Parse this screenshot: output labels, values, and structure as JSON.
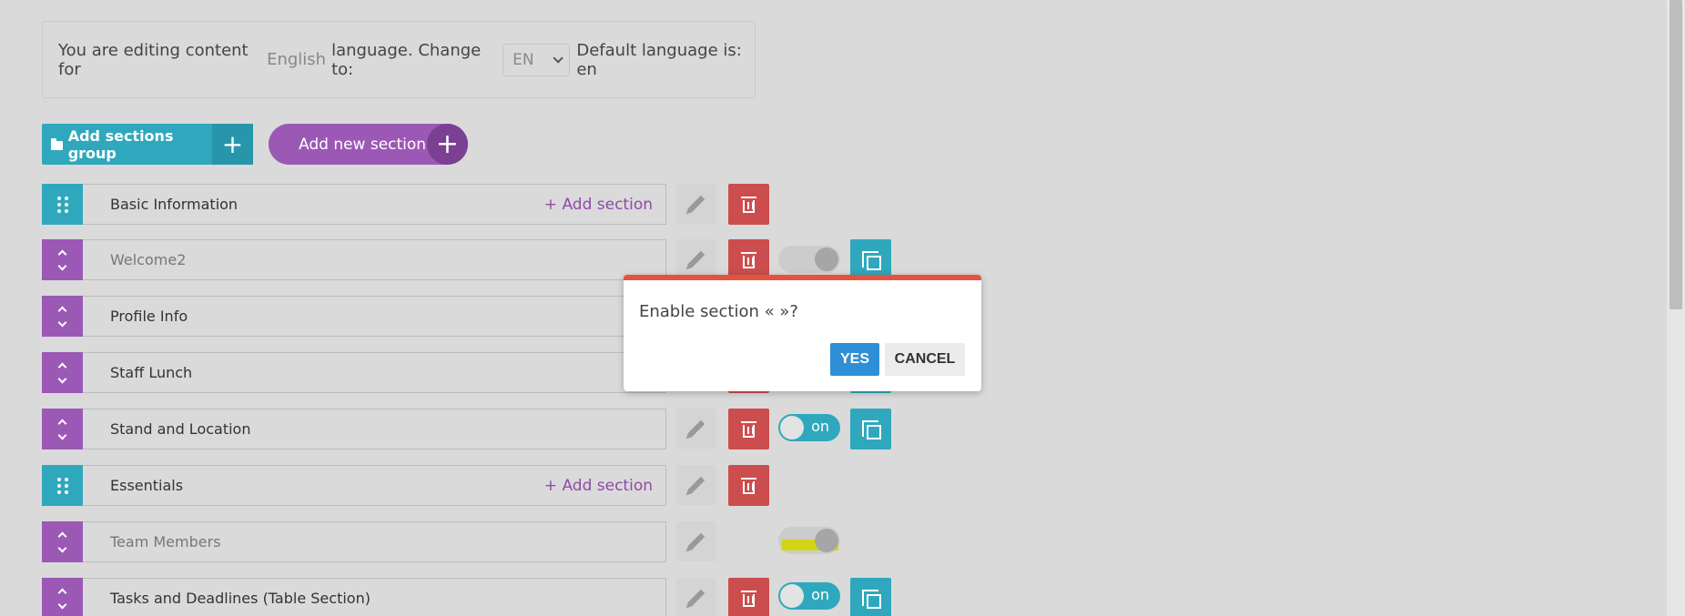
{
  "language_bar": {
    "prefix": "You are editing content for",
    "language": "English",
    "middle": "language. Change to:",
    "selected": "EN",
    "suffix": "Default language is: en"
  },
  "toolbar": {
    "add_group_label": "Add sections group",
    "add_section_label": "Add new section",
    "plus": "+"
  },
  "rows": [
    {
      "label": "Basic Information",
      "kind": "group",
      "add_label": "+ Add section"
    },
    {
      "label": "Welcome2",
      "kind": "item",
      "toggle": "off"
    },
    {
      "label": "Profile Info",
      "kind": "item"
    },
    {
      "label": "Staff Lunch",
      "kind": "item"
    },
    {
      "label": "Stand and Location",
      "kind": "item",
      "toggle": "on",
      "toggle_label": "on"
    },
    {
      "label": "Essentials",
      "kind": "group",
      "add_label": "+ Add section"
    },
    {
      "label": "Team Members",
      "kind": "item",
      "toggle": "off"
    },
    {
      "label": "Tasks and Deadlines (Table Section)",
      "kind": "item",
      "toggle": "on",
      "toggle_label": "on"
    }
  ],
  "dialog": {
    "message": "Enable section « »?",
    "yes_label": "YES",
    "cancel_label": "CANCEL",
    "accent_color": "#e2543f"
  },
  "colors": {
    "group": "#2fa8bd",
    "item": "#9b58b5",
    "delete": "#cc4d4d"
  }
}
